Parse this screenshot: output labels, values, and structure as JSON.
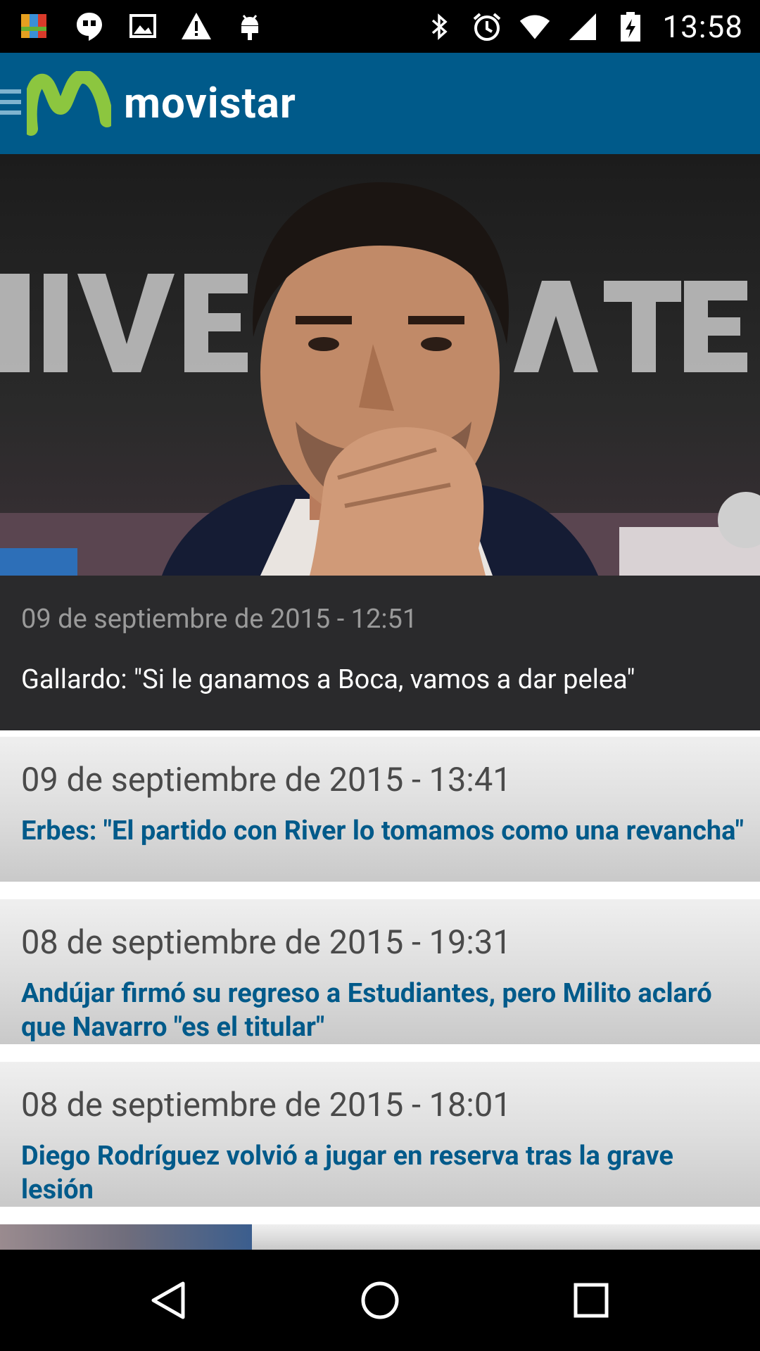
{
  "status_bar": {
    "time": "13:58",
    "left_icons": [
      "avg-antivirus-icon",
      "hangouts-icon",
      "gallery-icon",
      "warning-icon",
      "android-debug-icon"
    ],
    "right_icons": [
      "bluetooth-icon",
      "alarm-icon",
      "wifi-icon",
      "cell-signal-icon",
      "battery-charging-icon"
    ]
  },
  "app_bar": {
    "brand_name": "movistar",
    "menu_icon": "hamburger-icon"
  },
  "hero": {
    "date": "09 de septiembre de 2015 - 12:51",
    "title": "Gallardo: \"Si le ganamos a Boca, vamos a dar pelea\""
  },
  "news": [
    {
      "date": "09 de septiembre de 2015 - 13:41",
      "title": "Erbes: \"El partido con River lo tomamos como una revancha\""
    },
    {
      "date": "08 de septiembre de 2015 - 19:31",
      "title": "Andújar firmó su regreso a Estudiantes, pero Milito aclaró que Navarro \"es el titular\""
    },
    {
      "date": "08 de septiembre de 2015 - 18:01",
      "title": "Diego Rodríguez volvió a jugar en reserva tras la grave lesión"
    }
  ],
  "nav_bar": {
    "back": "back-icon",
    "home": "home-icon",
    "recents": "recents-icon"
  },
  "colors": {
    "app_bar": "#005a8a",
    "title_blue": "#005a8a",
    "logo_green": "#8cc63f",
    "hero_caption_bg": "#2a2a2c"
  }
}
